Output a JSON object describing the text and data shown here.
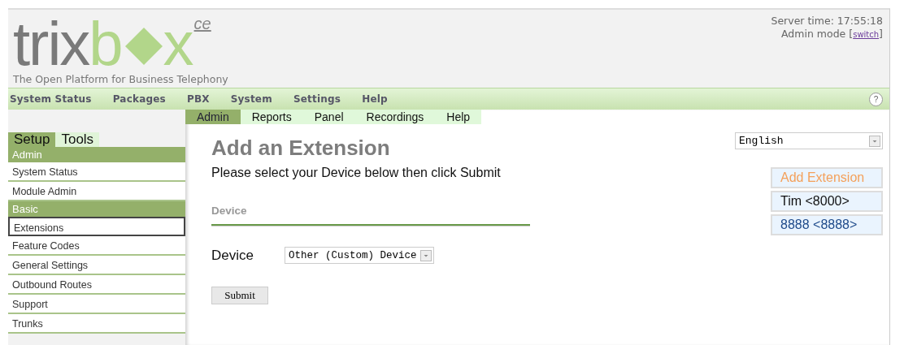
{
  "logo": {
    "part_1": "trix",
    "part_2": "b",
    "part_3": "x",
    "suffix": "ce",
    "tagline": "The Open Platform for Business Telephony"
  },
  "server": {
    "time": "Server time: 17:55:18",
    "mode": "Admin mode",
    "open_bracket": "[",
    "link": "switch",
    "close_bracket": "]"
  },
  "main_menu": [
    "System Status",
    "Packages",
    "PBX",
    "System",
    "Settings",
    "Help"
  ],
  "help_icon": "?",
  "sub_menu": [
    {
      "label": "Admin",
      "selected": true
    },
    {
      "label": "Reports",
      "selected": false
    },
    {
      "label": "Panel",
      "selected": false
    },
    {
      "label": "Recordings",
      "selected": false
    },
    {
      "label": "Help",
      "selected": false
    }
  ],
  "sidebar": {
    "tabs": [
      {
        "label": "Setup",
        "selected": true
      },
      {
        "label": "Tools",
        "selected": false
      }
    ],
    "items": [
      {
        "kind": "header",
        "label": "Admin"
      },
      {
        "kind": "link",
        "label": "System Status",
        "selected": false
      },
      {
        "kind": "link",
        "label": "Module Admin",
        "selected": false
      },
      {
        "kind": "header",
        "label": "Basic"
      },
      {
        "kind": "link",
        "label": "Extensions",
        "selected": true
      },
      {
        "kind": "link",
        "label": "Feature Codes",
        "selected": false
      },
      {
        "kind": "link",
        "label": "General Settings",
        "selected": false
      },
      {
        "kind": "link",
        "label": "Outbound Routes",
        "selected": false
      },
      {
        "kind": "link",
        "label": "Support",
        "selected": false
      },
      {
        "kind": "link",
        "label": "Trunks",
        "selected": false
      }
    ]
  },
  "page": {
    "title": "Add an Extension",
    "instruction": "Please select your Device below then click Submit",
    "section": "Device",
    "field_label": "Device",
    "device_value": "Other (Custom) Device",
    "submit": "Submit"
  },
  "language": "English",
  "extensions": [
    {
      "kind": "add",
      "label": "Add Extension"
    },
    {
      "kind": "named",
      "label": "Tim <8000>"
    },
    {
      "kind": "numeric",
      "label": "8888 <8888>"
    }
  ]
}
